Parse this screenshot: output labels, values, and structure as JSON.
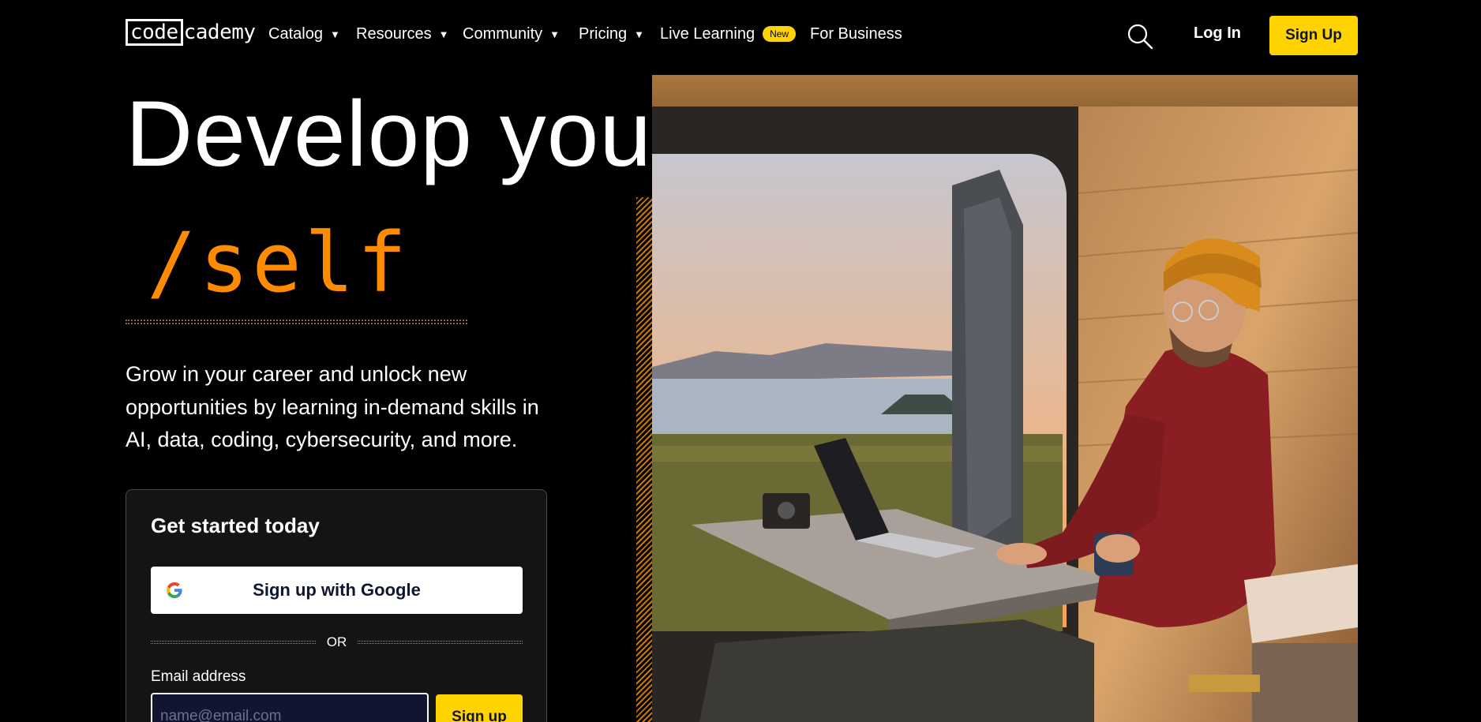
{
  "header": {
    "logo": {
      "boxed": "code",
      "rest": "cademy"
    },
    "nav": [
      {
        "label": "Catalog",
        "caret": "▼"
      },
      {
        "label": "Resources",
        "caret": "▼"
      },
      {
        "label": "Community",
        "caret": "▼"
      },
      {
        "label": "Pricing",
        "caret": "▼"
      },
      {
        "label": "Live Learning",
        "badge": "New"
      },
      {
        "label": "For Business"
      }
    ],
    "login": "Log In",
    "signup": "Sign Up"
  },
  "hero": {
    "title": "Develop your",
    "word": "/self",
    "subtitle": "Grow in your career and unlock new opportunities by learning in-demand skills in AI, data, coding, cybersecurity, and more."
  },
  "card": {
    "title": "Get started today",
    "google": "Sign up with Google",
    "or": "OR",
    "email_label": "Email address",
    "email_placeholder": "name@email.com",
    "submit": "Sign up"
  },
  "colors": {
    "accent": "#ffd300",
    "orange": "#ff8c00",
    "navy": "#10162f"
  }
}
